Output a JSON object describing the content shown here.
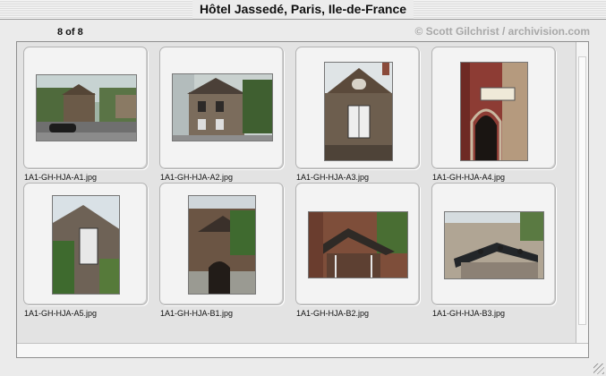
{
  "window": {
    "title": "Hôtel Jassedé, Paris, Ile-de-France"
  },
  "header": {
    "counter": "8 of 8",
    "credit": "© Scott Gilchrist / archivision.com"
  },
  "thumbnails": [
    {
      "filename": "1A1-GH-HJA-A1.jpg"
    },
    {
      "filename": "1A1-GH-HJA-A2.jpg"
    },
    {
      "filename": "1A1-GH-HJA-A3.jpg"
    },
    {
      "filename": "1A1-GH-HJA-A4.jpg"
    },
    {
      "filename": "1A1-GH-HJA-A5.jpg"
    },
    {
      "filename": "1A1-GH-HJA-B1.jpg"
    },
    {
      "filename": "1A1-GH-HJA-B2.jpg"
    },
    {
      "filename": "1A1-GH-HJA-B3.jpg"
    }
  ]
}
